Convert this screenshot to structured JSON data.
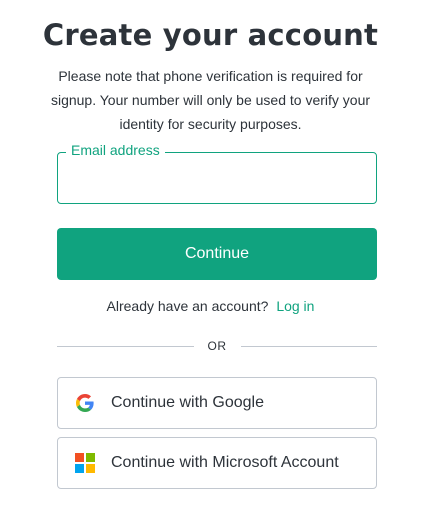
{
  "heading": {
    "title": "Create your account",
    "subtitle": "Please note that phone verification is required for signup. Your number will only be used to verify your identity for security purposes."
  },
  "email": {
    "label": "Email address",
    "value": "",
    "placeholder": ""
  },
  "continue_label": "Continue",
  "login": {
    "prompt": "Already have an account?",
    "link_label": "Log in"
  },
  "divider_label": "OR",
  "social": {
    "google_label": "Continue with Google",
    "microsoft_label": "Continue with Microsoft Account"
  },
  "colors": {
    "accent": "#10a37f",
    "text": "#2d333a",
    "border": "#c2c8d0",
    "google_blue": "#4285F4",
    "google_green": "#34A853",
    "google_yellow": "#FBBC05",
    "google_red": "#EA4335",
    "ms_red": "#F25022",
    "ms_green": "#7FBA00",
    "ms_blue": "#00A4EF",
    "ms_yellow": "#FFB900"
  }
}
